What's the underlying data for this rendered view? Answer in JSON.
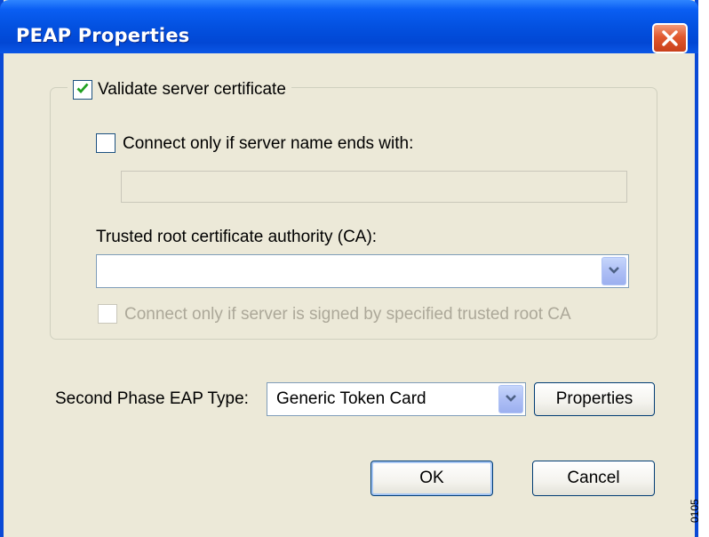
{
  "window": {
    "title": "PEAP Properties",
    "close_icon": "close-icon"
  },
  "validation": {
    "validate_server_certificate": {
      "label": "Validate server certificate",
      "checked": true
    },
    "connect_if_server_name_ends_with": {
      "label": "Connect only if server name ends with:",
      "checked": false,
      "value": ""
    },
    "trusted_root_ca": {
      "label": "Trusted root certificate authority (CA):",
      "selected": ""
    },
    "connect_if_signed_by_trusted_root": {
      "label": "Connect only if server is signed by specified trusted root CA",
      "checked": false,
      "enabled": false
    }
  },
  "second_phase": {
    "label": "Second Phase EAP Type:",
    "selected": "Generic Token Card",
    "properties_button": "Properties"
  },
  "buttons": {
    "ok": "OK",
    "cancel": "Cancel"
  },
  "side_text": "0105",
  "colors": {
    "titlebar": "#0351e0",
    "window_face": "#ece9d8",
    "checkmark": "#21a121",
    "close_button": "#e1582e",
    "disabled_text": "#aca899"
  }
}
